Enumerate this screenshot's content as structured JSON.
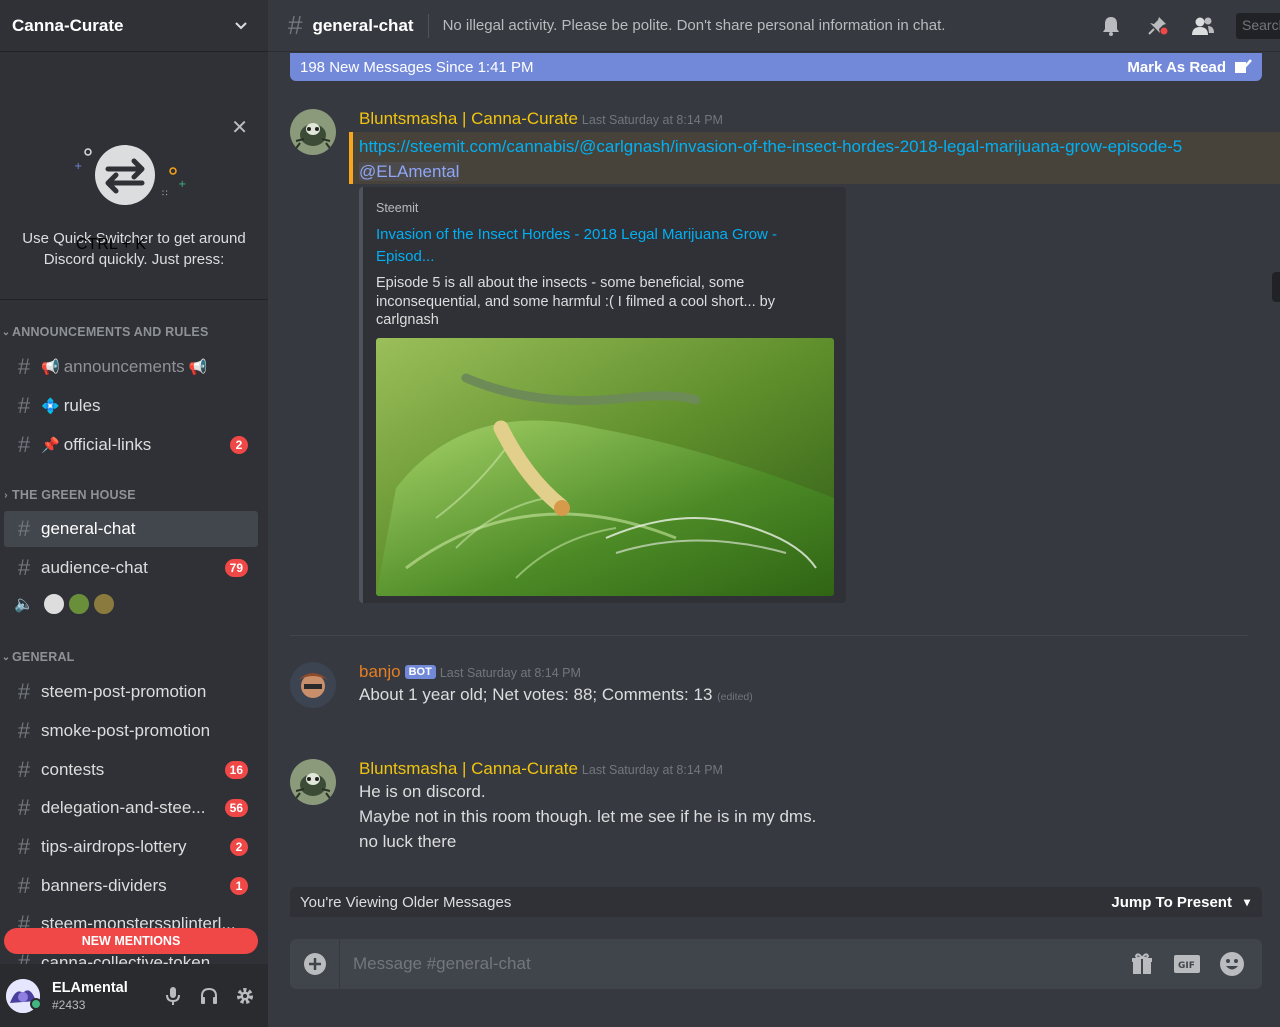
{
  "server": {
    "name": "Canna-Curate"
  },
  "switcher": {
    "description": "Use Quick Switcher to get around Discord quickly. Just press:",
    "shortcut": "CTRL + K"
  },
  "categories": [
    {
      "name": "ANNOUNCEMENTS AND RULES"
    },
    {
      "name": "THE GREEN HOUSE"
    },
    {
      "name": "GENERAL"
    }
  ],
  "channels": [
    {
      "name": "announcements",
      "badge": "",
      "muted": true,
      "emoji_before": "📢",
      "emoji_after": "📢"
    },
    {
      "name": "rules",
      "badge": "",
      "muted": false,
      "emoji_before": "💠"
    },
    {
      "name": "official-links",
      "badge": "2",
      "muted": false,
      "emoji_before": "📌"
    },
    {
      "name": "general-chat",
      "badge": "",
      "active": true
    },
    {
      "name": "audience-chat",
      "badge": "79"
    },
    {
      "name": "steem-post-promotion",
      "badge": ""
    },
    {
      "name": "smoke-post-promotion",
      "badge": ""
    },
    {
      "name": "contests",
      "badge": "16"
    },
    {
      "name": "delegation-and-stee...",
      "badge": "56"
    },
    {
      "name": "tips-airdrops-lottery",
      "badge": "2"
    },
    {
      "name": "banners-dividers",
      "badge": "1"
    },
    {
      "name": "steem-monsterssplinterl...",
      "badge": ""
    },
    {
      "name": "canna-collective-token",
      "badge": ""
    }
  ],
  "new_mentions": "NEW MENTIONS",
  "user": {
    "name": "ELAmental",
    "discriminator": "#2433"
  },
  "channel_header": {
    "name": "general-chat",
    "topic": "No illegal activity. Please be polite. Don't share personal information in chat.",
    "search_placeholder": "Search"
  },
  "new_messages_bar": {
    "text": "198 New Messages Since 1:41 PM",
    "mark_read": "Mark As Read"
  },
  "messages": [
    {
      "author": "Bluntsmasha | Canna-Curate",
      "timestamp": "Last Saturday at 8:14 PM",
      "link": "https://steemit.com/cannabis/@carlgnash/invasion-of-the-insect-hordes-2018-legal-marijuana-grow-episode-5",
      "mention": "@ELAmental",
      "embed": {
        "provider": "Steemit",
        "title": "Invasion of the Insect Hordes - 2018 Legal Marijuana Grow - Episod...",
        "description": "Episode 5 is all about the insects - some beneficial, some inconsequential, and some harmful :( I filmed a cool short... by carlgnash"
      }
    },
    {
      "author": "banjo",
      "bot_tag": "BOT",
      "timestamp": "Last Saturday at 8:14 PM",
      "text": "About 1 year old; Net votes: 88; Comments: 13",
      "edited": "(edited)"
    },
    {
      "author": "Bluntsmasha | Canna-Curate",
      "timestamp": "Last Saturday at 8:14 PM",
      "lines": [
        "He is on discord.",
        "Maybe not in this room though. let me see if he is in my dms.",
        "no luck there"
      ]
    }
  ],
  "older_bar": {
    "text": "You're Viewing Older Messages",
    "jump": "Jump To Present"
  },
  "composer": {
    "placeholder": "Message #general-chat"
  },
  "colors": {
    "blurple": "#7289da",
    "mention_red": "#f04747",
    "author_gold": "#f1c40f",
    "bot_orange": "#e67e22",
    "link_blue": "#00b0f4"
  }
}
